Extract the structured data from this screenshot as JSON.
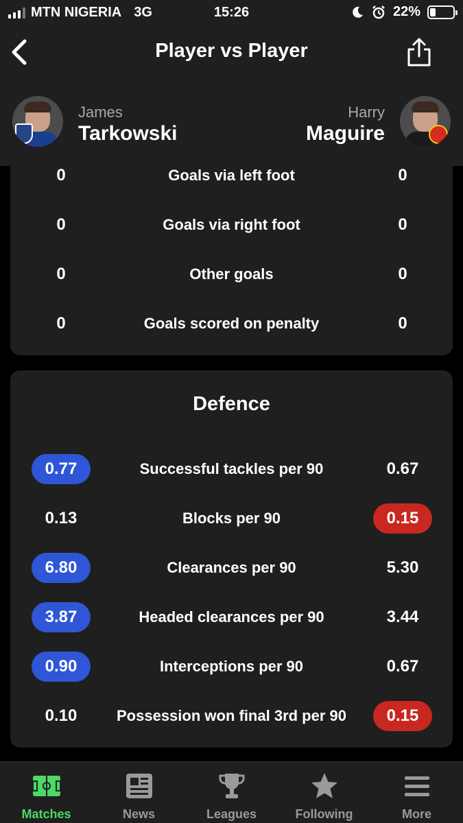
{
  "status_bar": {
    "carrier": "MTN NIGERIA",
    "network": "3G",
    "time": "15:26",
    "battery": "22%",
    "battery_level": 0.22
  },
  "header": {
    "title": "Player vs Player",
    "back_icon": "chevron-left-icon",
    "share_icon": "share-icon"
  },
  "players": {
    "left": {
      "first_name": "James",
      "last_name": "Tarkowski",
      "club_badge": "everton-badge"
    },
    "right": {
      "first_name": "Harry",
      "last_name": "Maguire",
      "club_badge": "manchester-united-badge"
    }
  },
  "goals_section": {
    "rows": [
      {
        "label": "Goals via left foot",
        "left": "0",
        "right": "0"
      },
      {
        "label": "Goals via right foot",
        "left": "0",
        "right": "0"
      },
      {
        "label": "Other goals",
        "left": "0",
        "right": "0"
      },
      {
        "label": "Goals scored on penalty",
        "left": "0",
        "right": "0"
      }
    ]
  },
  "defence_section": {
    "heading": "Defence",
    "rows": [
      {
        "label": "Successful tackles per 90",
        "left": "0.77",
        "right": "0.67",
        "highlight": "left"
      },
      {
        "label": "Blocks per 90",
        "left": "0.13",
        "right": "0.15",
        "highlight": "right"
      },
      {
        "label": "Clearances per 90",
        "left": "6.80",
        "right": "5.30",
        "highlight": "left"
      },
      {
        "label": "Headed clearances per 90",
        "left": "3.87",
        "right": "3.44",
        "highlight": "left"
      },
      {
        "label": "Interceptions per 90",
        "left": "0.90",
        "right": "0.67",
        "highlight": "left"
      },
      {
        "label": "Possession won final 3rd per 90",
        "left": "0.10",
        "right": "0.15",
        "highlight": "right"
      }
    ]
  },
  "colors": {
    "left_highlight": "#2e56d6",
    "right_highlight": "#c8281f",
    "active_tab": "#4cd964"
  },
  "tab_bar": {
    "tabs": [
      {
        "label": "Matches",
        "icon": "pitch-icon",
        "active": true
      },
      {
        "label": "News",
        "icon": "newspaper-icon",
        "active": false
      },
      {
        "label": "Leagues",
        "icon": "trophy-icon",
        "active": false
      },
      {
        "label": "Following",
        "icon": "star-icon",
        "active": false
      },
      {
        "label": "More",
        "icon": "menu-icon",
        "active": false
      }
    ]
  }
}
